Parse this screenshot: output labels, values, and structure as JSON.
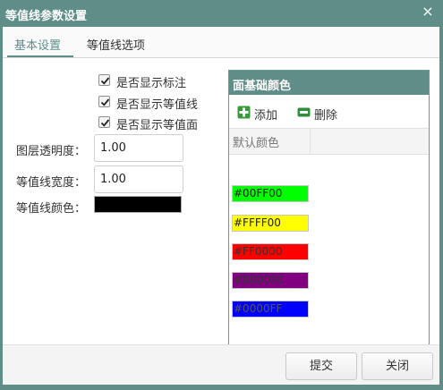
{
  "window": {
    "title": "等值线参数设置",
    "close_glyph": "×"
  },
  "tabs": [
    {
      "label": "基本设置",
      "active": true
    },
    {
      "label": "等值线选项",
      "active": false
    }
  ],
  "basic": {
    "checkboxes": [
      {
        "label": "是否显示标注",
        "checked": true
      },
      {
        "label": "是否显示等值线",
        "checked": true
      },
      {
        "label": "是否显示等值面",
        "checked": true
      }
    ],
    "opacity_label": "图层透明度：",
    "opacity_value": "1.00",
    "width_label": "等值线宽度：",
    "width_value": "1.00",
    "color_label": "等值线颜色：",
    "color_value": "#000000"
  },
  "panel": {
    "title": "面基础颜色",
    "add_label": "添加",
    "add_icon": "plus-icon",
    "delete_label": "删除",
    "delete_icon": "minus-icon",
    "column_header": "默认颜色",
    "colors": [
      {
        "value": "#00FF00",
        "text_color": "#222222"
      },
      {
        "value": "#FFFF00",
        "text_color": "#222222"
      },
      {
        "value": "#FF0000",
        "text_color": "#333333"
      },
      {
        "value": "#800080",
        "text_color": "#333333"
      },
      {
        "value": "#0000FF",
        "text_color": "#555555"
      }
    ]
  },
  "footer": {
    "submit_label": "提交",
    "close_label": "关闭"
  },
  "colors": {
    "accent": "#5f8e89",
    "check_icon": "checkmark-icon"
  }
}
